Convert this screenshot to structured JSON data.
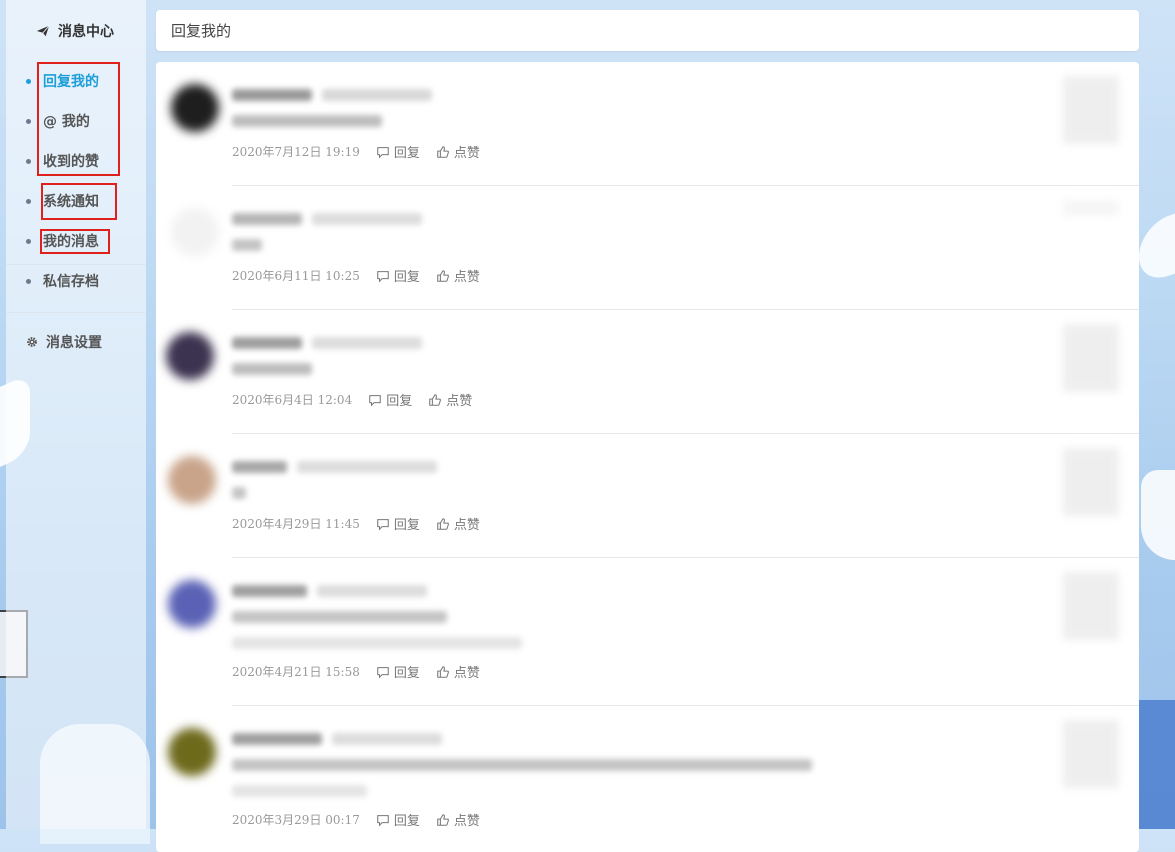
{
  "sidebar": {
    "title": "消息中心",
    "items": [
      {
        "label": "回复我的",
        "active": true
      },
      {
        "label": "@ 我的",
        "active": false
      },
      {
        "label": "收到的赞",
        "active": false
      },
      {
        "label": "系统通知",
        "active": false
      },
      {
        "label": "我的消息",
        "active": false
      },
      {
        "label": "私信存档",
        "active": false
      }
    ],
    "settings_label": "消息设置"
  },
  "header": {
    "title": "回复我的"
  },
  "replies": [
    {
      "time": "2020年7月12日 19:19",
      "reply_label": "回复",
      "like_label": "点赞"
    },
    {
      "time": "2020年6月11日 10:25",
      "reply_label": "回复",
      "like_label": "点赞"
    },
    {
      "time": "2020年6月4日 12:04",
      "reply_label": "回复",
      "like_label": "点赞"
    },
    {
      "time": "2020年4月29日 11:45",
      "reply_label": "回复",
      "like_label": "点赞"
    },
    {
      "time": "2020年4月21日 15:58",
      "reply_label": "回复",
      "like_label": "点赞"
    },
    {
      "time": "2020年3月29日 00:17",
      "reply_label": "回复",
      "like_label": "点赞"
    }
  ],
  "colors": {
    "accent": "#1c9ed8",
    "highlight_box": "#e0201a"
  }
}
